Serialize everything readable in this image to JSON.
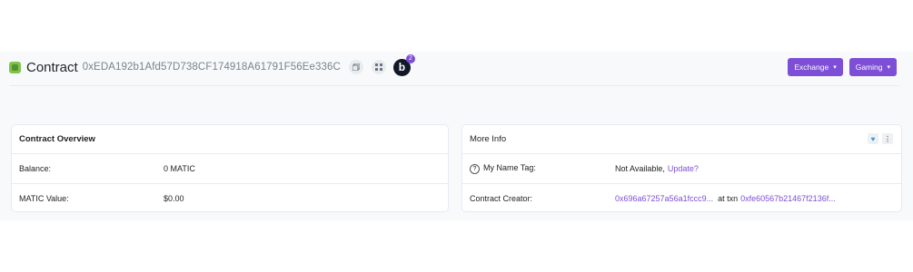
{
  "header": {
    "title": "Contract",
    "address": "0xEDA192b1Afd57D738CF174918A61791F56Ee336C",
    "copy_icon": "copy-icon",
    "qr_icon": "qr-code-icon",
    "badge_letter": "b",
    "badge_count": "2"
  },
  "buttons": {
    "exchange": "Exchange",
    "gaming": "Gaming"
  },
  "overview": {
    "title": "Contract Overview",
    "rows": [
      {
        "label": "Balance:",
        "value": "0 MATIC"
      },
      {
        "label": "MATIC Value:",
        "value": "$0.00"
      }
    ]
  },
  "more_info": {
    "title": "More Info",
    "name_tag_label": "My Name Tag:",
    "name_tag_value": "Not Available,",
    "name_tag_link": "Update?",
    "creator_label": "Contract Creator:",
    "creator_address": "0x696a67257a56a1fccc9...",
    "creator_at": "at txn",
    "creator_txn": "0xfe60567b21467f2136f..."
  },
  "colors": {
    "accent": "#7d4ed6",
    "logo": "#80c34a"
  }
}
